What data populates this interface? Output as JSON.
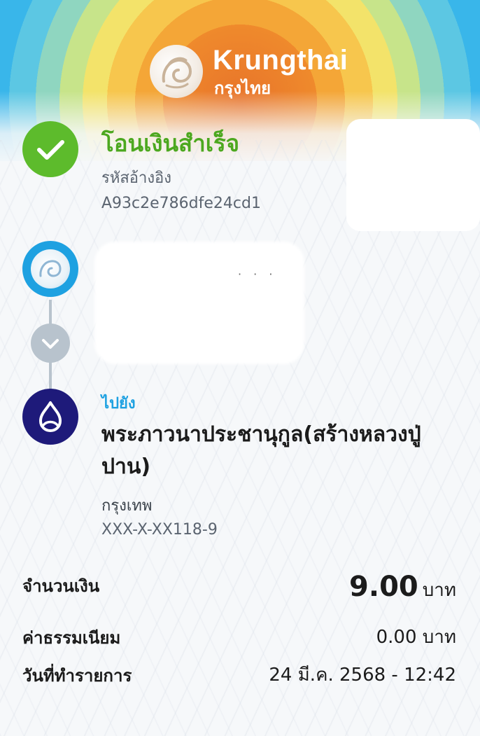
{
  "brand": {
    "name_en": "Krungthai",
    "name_th": "กรุงไทย",
    "colors": {
      "primary": "#1ea1e1",
      "success": "#5dbb2c",
      "recipient_bank": "#1e1a7a"
    }
  },
  "status": {
    "title": "โอนเงินสำเร็จ",
    "ref_label": "รหัสอ้างอิง",
    "ref_value": "A93c2e786dfe24cd1",
    "icon": "check-icon"
  },
  "sender": {
    "icon": "krungthai-logo-icon",
    "masked_dots": "· · ·"
  },
  "recipient": {
    "label": "ไปยัง",
    "name": "พระภาวนาประชานุกูล(สร้างหลวงปู่ปาน)",
    "bank": "กรุงเทพ",
    "account": "XXX-X-XX118-9",
    "icon": "bangkok-bank-logo-icon"
  },
  "details": {
    "amount_label": "จำนวนเงิน",
    "amount_value": "9.00",
    "amount_unit": "บาท",
    "fee_label": "ค่าธรรมเนียม",
    "fee_value": "0.00 บาท",
    "date_label": "วันที่ทำรายการ",
    "date_value": "24 มี.ค. 2568 - 12:42"
  }
}
